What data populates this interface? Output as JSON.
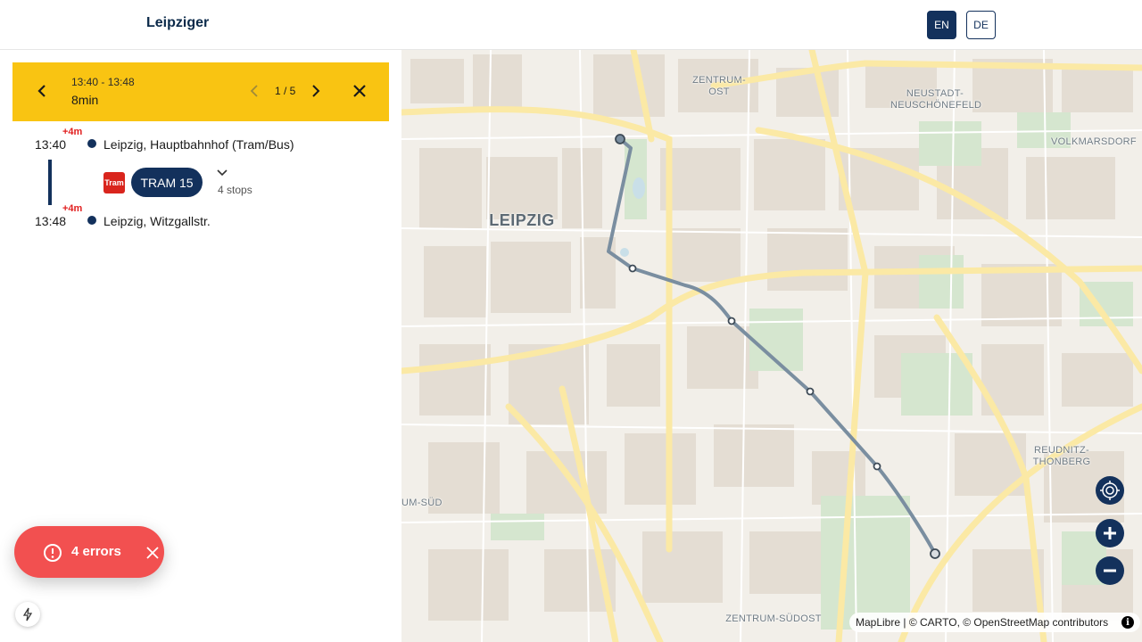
{
  "header": {
    "title": "Leipziger",
    "languages": [
      {
        "label": "EN",
        "active": true
      },
      {
        "label": "DE",
        "active": false
      }
    ]
  },
  "trip": {
    "time_range": "13:40 - 13:48",
    "duration": "8min",
    "page": "1 / 5",
    "from": {
      "delay": "+4m",
      "time": "13:40",
      "name": "Leipzig, Hauptbahnhof (Tram/Bus)"
    },
    "to": {
      "delay": "+4m",
      "time": "13:48",
      "name": "Leipzig, Witzgallstr."
    },
    "leg": {
      "mode_icon": "Tram",
      "line": "TRAM 15",
      "stops": "4 stops",
      "color": "#13315c",
      "mode_color": "#d9251d"
    }
  },
  "toast": {
    "text": "4 errors",
    "color": "#f25050"
  },
  "map": {
    "labels": {
      "zentrum_ost": "ZENTRUM-OST",
      "neustadt": "NEUSTADT-\nNEUSCHÖNEFELD",
      "volkmarsdorf": "VOLKMARSDORF",
      "leipzig": "LEIPZIG",
      "reudnitz": "REUDNITZ-\nTHONBERG",
      "zentrum_sued": "UM-SÜD",
      "zentrum_suedost": "ZENTRUM-SÜDOST"
    },
    "attribution": {
      "maplibre": "MapLibre",
      "carto": "© CARTO",
      "osm": "© OpenStreetMap",
      "contributors": "contributors"
    }
  },
  "icons": {
    "back": "chevron-left-icon",
    "prev": "chevron-left-icon",
    "next": "chevron-right-icon",
    "close": "close-icon",
    "expand": "chevron-down-icon",
    "error": "alert-circle-icon",
    "locate": "locate-icon",
    "zoom_in": "plus-icon",
    "zoom_out": "minus-icon",
    "info": "info-icon",
    "devtools": "lightning-icon"
  },
  "colors": {
    "accent": "#f9c412",
    "primary": "#13315c",
    "delay": "#e12020",
    "route": "#7a8ea0"
  }
}
